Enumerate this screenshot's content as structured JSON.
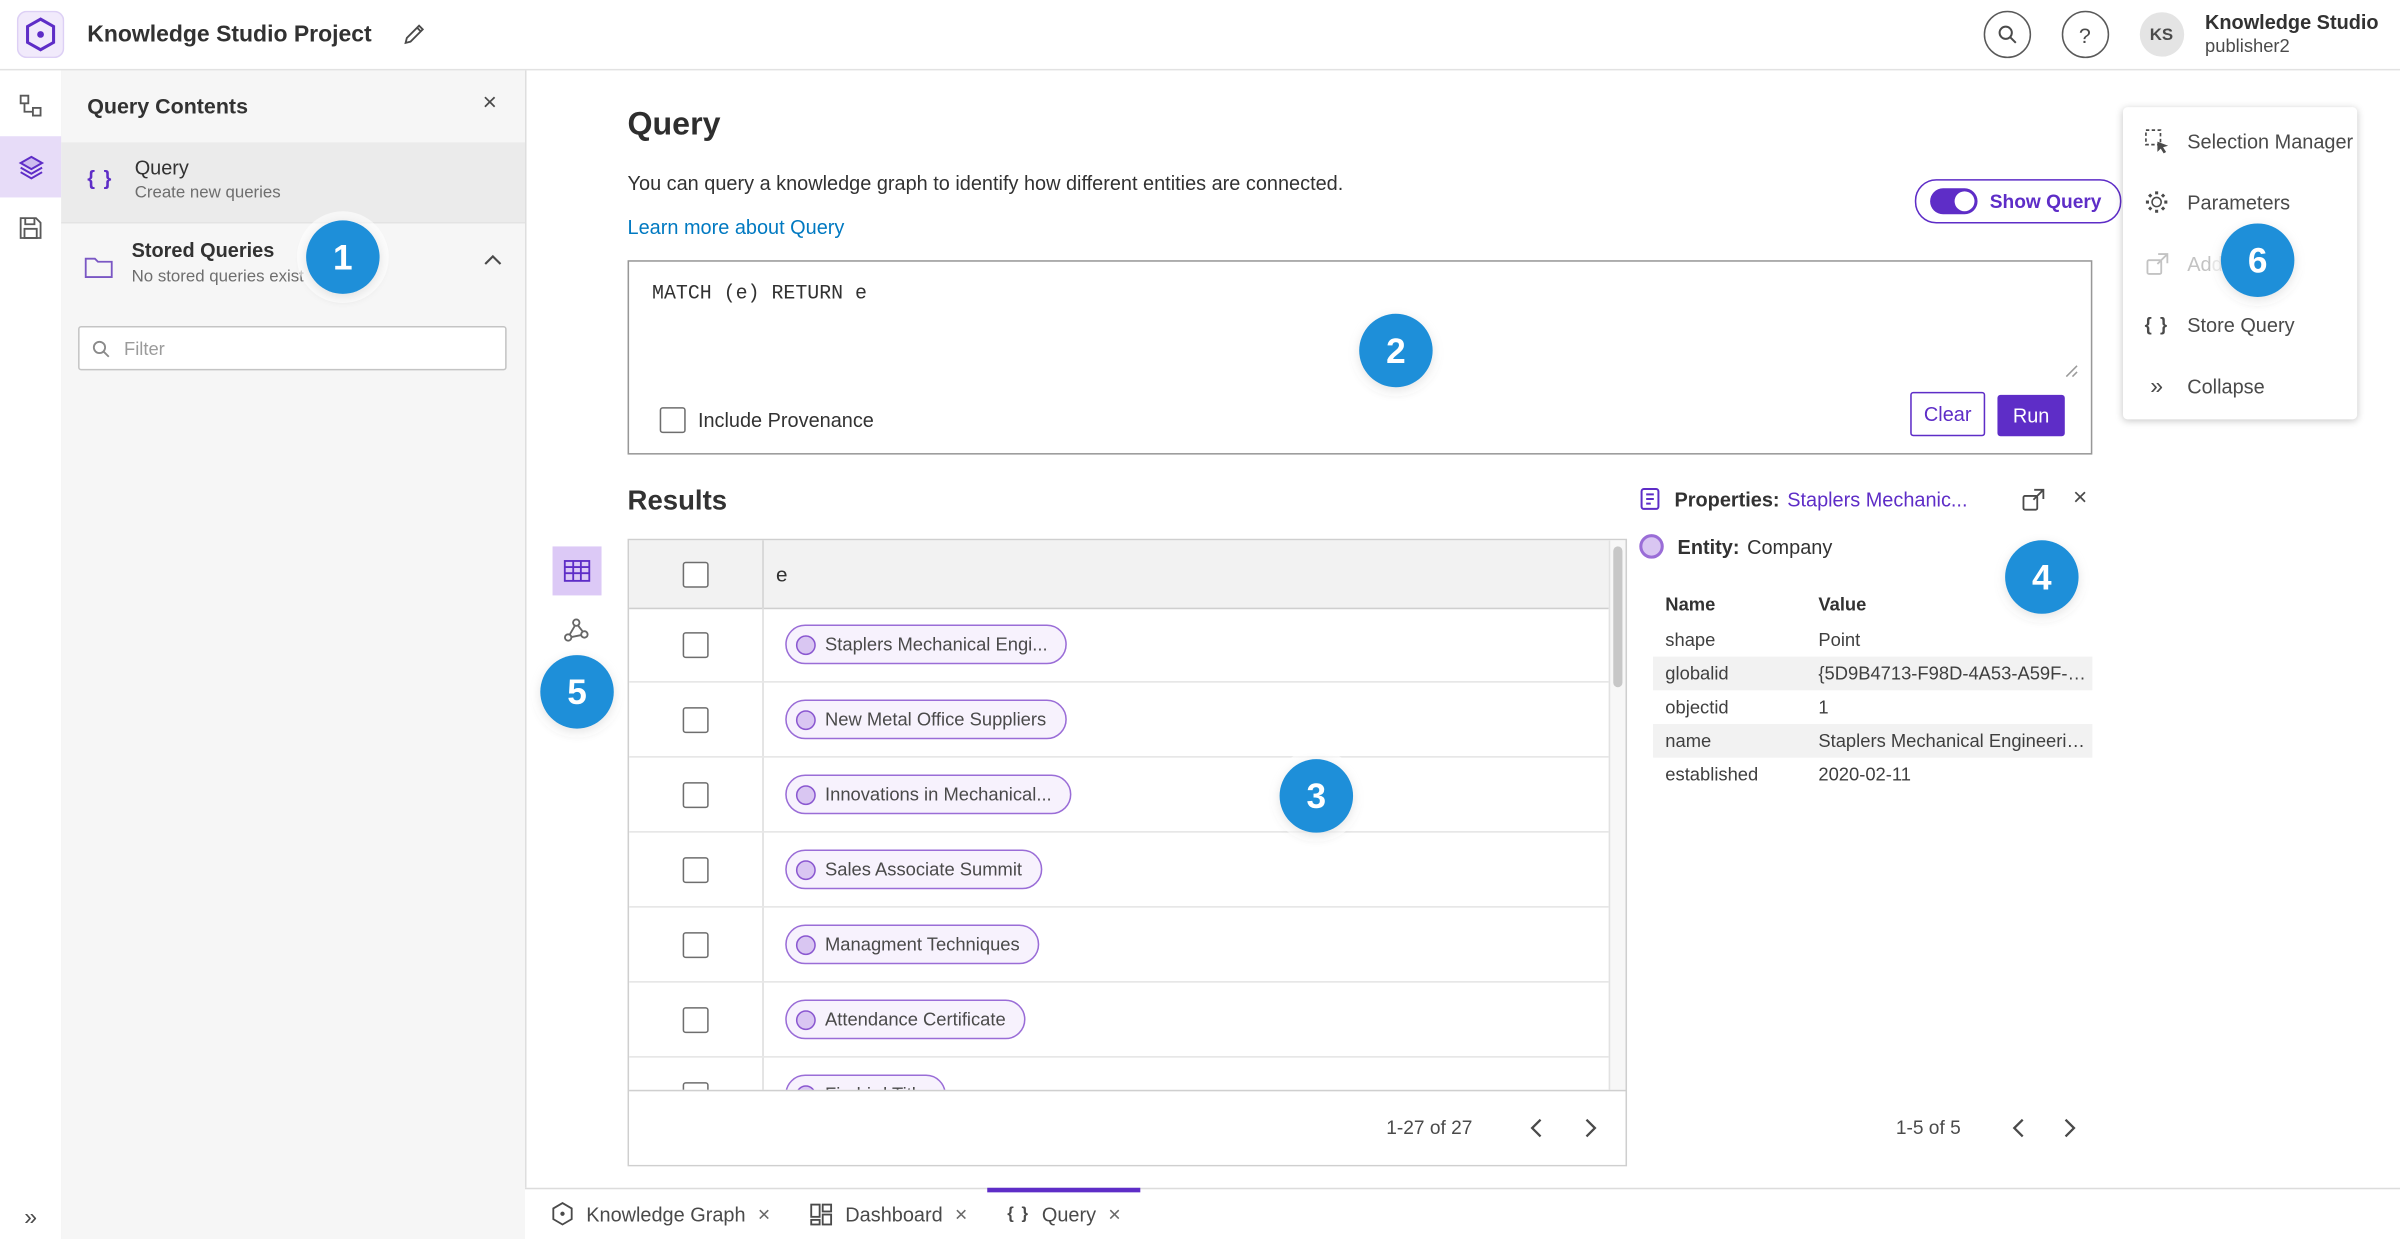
{
  "colors": {
    "accent_purple": "#5e2dc7",
    "accent_purple_light": "#9a6dd7",
    "link_blue": "#0079c1",
    "annotation_blue": "#1e8fd9"
  },
  "icons": {
    "braces": "{ }",
    "collapse": "»",
    "close": "×",
    "help": "?"
  },
  "header": {
    "title": "Knowledge Studio Project",
    "user_initials": "KS",
    "user_name": "Knowledge Studio",
    "user_role": "publisher2"
  },
  "sidebar": {
    "title": "Query Contents",
    "query_item_label": "Query",
    "query_item_sublabel": "Create new queries",
    "stored_label": "Stored Queries",
    "stored_sublabel": "No stored queries exist",
    "filter_placeholder": "Filter"
  },
  "query": {
    "title": "Query",
    "description": "You can query a knowledge graph to identify how different entities are connected.",
    "learn_more": "Learn more about Query",
    "show_query": "Show Query",
    "text": "MATCH (e) RETURN e",
    "include_provenance": "Include Provenance",
    "clear": "Clear",
    "run": "Run"
  },
  "results": {
    "title": "Results",
    "column": "e",
    "rows": [
      "Staplers Mechanical Engi...",
      "New Metal Office Suppliers",
      "Innovations in Mechanical...",
      "Sales Associate Summit",
      "Managment Techniques",
      "Attendance Certificate",
      "Firebird Title"
    ],
    "pagination": "1-27 of 27"
  },
  "properties": {
    "label": "Properties:",
    "entity_link": "Staplers Mechanic...",
    "entity_label": "Entity:",
    "entity_value": "Company",
    "col_name": "Name",
    "col_value": "Value",
    "rows": [
      {
        "name": "shape",
        "value": "Point"
      },
      {
        "name": "globalid",
        "value": "{5D9B4713-F98D-4A53-A59F-C11..."
      },
      {
        "name": "objectid",
        "value": "1"
      },
      {
        "name": "name",
        "value": "Staplers Mechanical Engineering"
      },
      {
        "name": "established",
        "value": "2020-02-11"
      }
    ],
    "pagination": "1-5 of 5"
  },
  "actions": {
    "items": [
      {
        "label": "Selection Manager"
      },
      {
        "label": "Parameters"
      },
      {
        "label": "Add To Map"
      },
      {
        "label": "Store Query"
      },
      {
        "label": "Collapse"
      }
    ]
  },
  "tabs": [
    {
      "label": "Knowledge Graph"
    },
    {
      "label": "Dashboard"
    },
    {
      "label": "Query"
    }
  ],
  "annotations": [
    "1",
    "2",
    "3",
    "4",
    "5",
    "6"
  ]
}
